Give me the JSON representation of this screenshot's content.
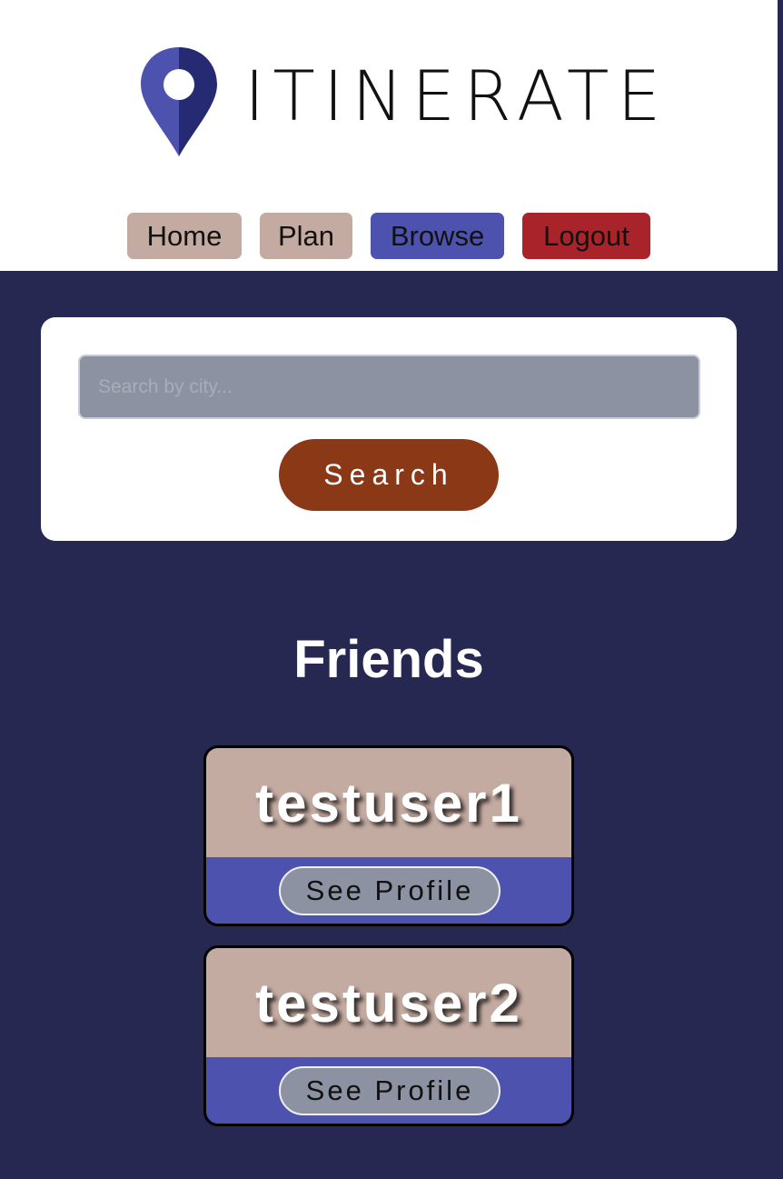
{
  "brand": {
    "name": "ITINERATE",
    "icon": "map-pin-icon",
    "colors": {
      "pin_light": "#4c52ae",
      "pin_dark": "#262a72"
    }
  },
  "nav": {
    "home": "Home",
    "plan": "Plan",
    "browse": "Browse",
    "logout": "Logout",
    "active": "Browse"
  },
  "search": {
    "placeholder": "Search by city...",
    "value": "",
    "button_label": "Search"
  },
  "friends": {
    "title": "Friends",
    "items": [
      {
        "username": "testuser1",
        "action_label": "See Profile"
      },
      {
        "username": "testuser2",
        "action_label": "See Profile"
      }
    ]
  },
  "colors": {
    "page_background": "#262852",
    "nav_default": "#c4aba1",
    "nav_active": "#4c52ae",
    "nav_logout": "#a8242a",
    "search_button": "#8a3816"
  }
}
